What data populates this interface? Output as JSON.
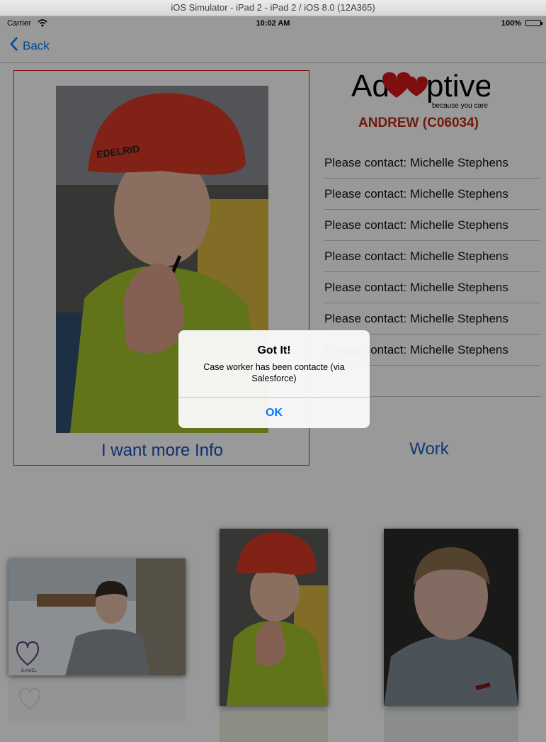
{
  "window": {
    "title": "iOS Simulator - iPad 2 - iPad 2 / iOS 8.0 (12A365)"
  },
  "status_bar": {
    "carrier": "Carrier",
    "time": "10:02 AM",
    "battery": "100%"
  },
  "nav": {
    "back_label": "Back"
  },
  "logo": {
    "word_left": "Ad",
    "word_right": "ptive",
    "tagline": "because you care"
  },
  "profile": {
    "name": "ANDREW (C06034)",
    "more_info_label": "I want more Info",
    "work_label": "Work",
    "contacts": [
      "Please contact: Michelle Stephens",
      "Please contact: Michelle Stephens",
      "Please contact: Michelle Stephens",
      "Please contact: Michelle Stephens",
      "Please contact: Michelle Stephens",
      "Please contact: Michelle Stephens",
      "Please contact: Michelle Stephens",
      ""
    ],
    "helmet_text": "EDELRID"
  },
  "thumbnails": {
    "left_logo_text": "DANIEL"
  },
  "alert": {
    "title": "Got It!",
    "message": "Case worker has been contacte (via Salesforce)",
    "ok_label": "OK"
  },
  "colors": {
    "accent": "#007aff",
    "name_red": "#c22a1a",
    "link_blue": "#1a4fbf",
    "frame_red": "#e02020"
  }
}
